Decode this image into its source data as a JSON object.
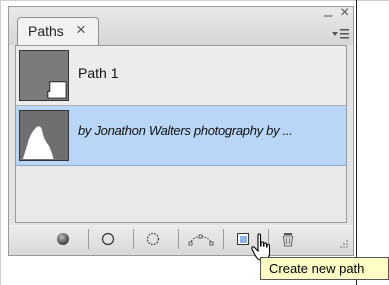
{
  "panel": {
    "tab_label": "Paths",
    "tab_close_glyph": "×",
    "collapse_glyph": "–",
    "close_glyph": "×",
    "menu_icon": "panel-menu-icon"
  },
  "paths": [
    {
      "label": "Path 1",
      "thumbnail": "gray-shape-thumbnail",
      "selected": false
    },
    {
      "label": "by Jonathon Walters photography by ...",
      "thumbnail": "white-silhouette-thumbnail",
      "selected": true
    }
  ],
  "footer_buttons": [
    {
      "name": "fill-path-button",
      "icon": "filled-circle-icon"
    },
    {
      "name": "stroke-path-button",
      "icon": "circle-outline-icon"
    },
    {
      "name": "load-as-selection-button",
      "icon": "dotted-circle-icon"
    },
    {
      "name": "make-work-path-button",
      "icon": "work-path-icon"
    },
    {
      "name": "create-new-path-button",
      "icon": "new-path-icon"
    },
    {
      "name": "delete-path-button",
      "icon": "trash-icon"
    }
  ],
  "tooltip": {
    "text": "Create new path"
  },
  "colors": {
    "selected_row": "#b9d6f7",
    "tooltip_bg": "#fefdc5",
    "panel_bg": "#e3e3e3"
  }
}
